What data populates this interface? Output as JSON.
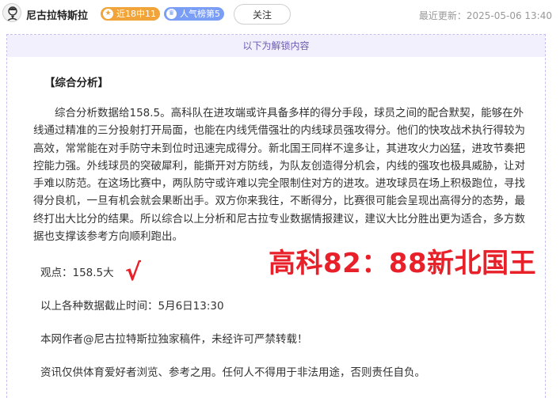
{
  "header": {
    "author_name": "尼古拉特斯拉",
    "badge_streak": "近18中11",
    "badge_popularity": "人气榜第5",
    "follow_label": "关注",
    "last_update": "最近更新：2025-05-06 13:40"
  },
  "article": {
    "unlock_notice": "以下为解锁内容",
    "section_title": "【综合分析】",
    "analysis_text": "综合分析数据给158.5。高科队在进攻端或许具备多样的得分手段，球员之间的配合默契，能够在外线通过精准的三分投射打开局面，也能在内线凭借强壮的内线球员强攻得分。他们的快攻战术执行得较为高效，常常能在对手防守未到位时迅速完成得分。新北国王同样不遑多让，其进攻火力凶猛，进攻节奏把控能力强。外线球员的突破犀利，能撕开对方防线，为队友创造得分机会，内线的强攻也极具威胁，让对手难以防范。在这场比赛中，两队防守或许难以完全限制住对方的进攻。进攻球员在场上积极跑位，寻找得分良机，一旦有机会就会果断出手。双方你来我往，不断得分，比赛很可能会呈现出高得分的态势，最终打出大比分的结果。所以综合以上分析和尼古拉专业数据情报建议，建议大比分胜出更为适合，多方数据也支撑该参考方向顺利跑出。",
    "viewpoint": "观点：158.5大",
    "checkmark": "√",
    "data_cutoff": "以上各种数据截止时间：5月6日13:30",
    "copyright": "本网作者@尼古拉特斯拉独家稿件，未经许可严禁转载！",
    "disclaimer": "资讯仅供体育爱好者浏览、参考之用。任何人不得用于非法用途，否则责任自负。",
    "final_score": "高科82：88新北国王"
  },
  "colors": {
    "accent_red": "#e8202a",
    "streak_badge": "#f0a43a",
    "rank_badge": "#7a9df5",
    "unlock_bg": "#f3f0fd"
  },
  "icons": {
    "avatar": "avatar-portrait",
    "streak": "star-icon",
    "popularity": "crown-icon"
  }
}
